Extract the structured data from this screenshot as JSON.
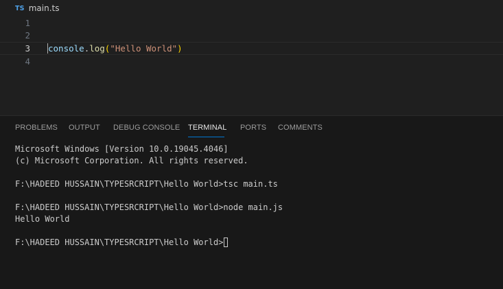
{
  "editor": {
    "file_icon": "TS",
    "file_name": "main.ts",
    "lines": [
      {
        "number": "1",
        "code": ""
      },
      {
        "number": "2",
        "code": ""
      },
      {
        "number": "3",
        "code": "console.log(\"Hello World\")"
      },
      {
        "number": "4",
        "code": ""
      }
    ],
    "code_tokens": {
      "object": "console",
      "dot": ".",
      "method": "log",
      "open_paren": "(",
      "string": "\"Hello World\"",
      "close_paren": ")"
    }
  },
  "panel": {
    "tabs": [
      {
        "label": "PROBLEMS"
      },
      {
        "label": "OUTPUT"
      },
      {
        "label": "DEBUG CONSOLE"
      },
      {
        "label": "TERMINAL",
        "active": true
      },
      {
        "label": "PORTS"
      },
      {
        "label": "COMMENTS"
      }
    ]
  },
  "terminal": {
    "lines": [
      "Microsoft Windows [Version 10.0.19045.4046]",
      "(c) Microsoft Corporation. All rights reserved.",
      "",
      "F:\\HADEED HUSSAIN\\TYPESRCRIPT\\Hello World>tsc main.ts",
      "",
      "F:\\HADEED HUSSAIN\\TYPESRCRIPT\\Hello World>node main.js",
      "Hello World",
      "",
      "F:\\HADEED HUSSAIN\\TYPESRCRIPT\\Hello World>"
    ]
  },
  "colors": {
    "accent": "#0078d4",
    "editor_bg": "#1f1f1f",
    "panel_bg": "#181818",
    "ts_icon": "#4ea1e8"
  }
}
